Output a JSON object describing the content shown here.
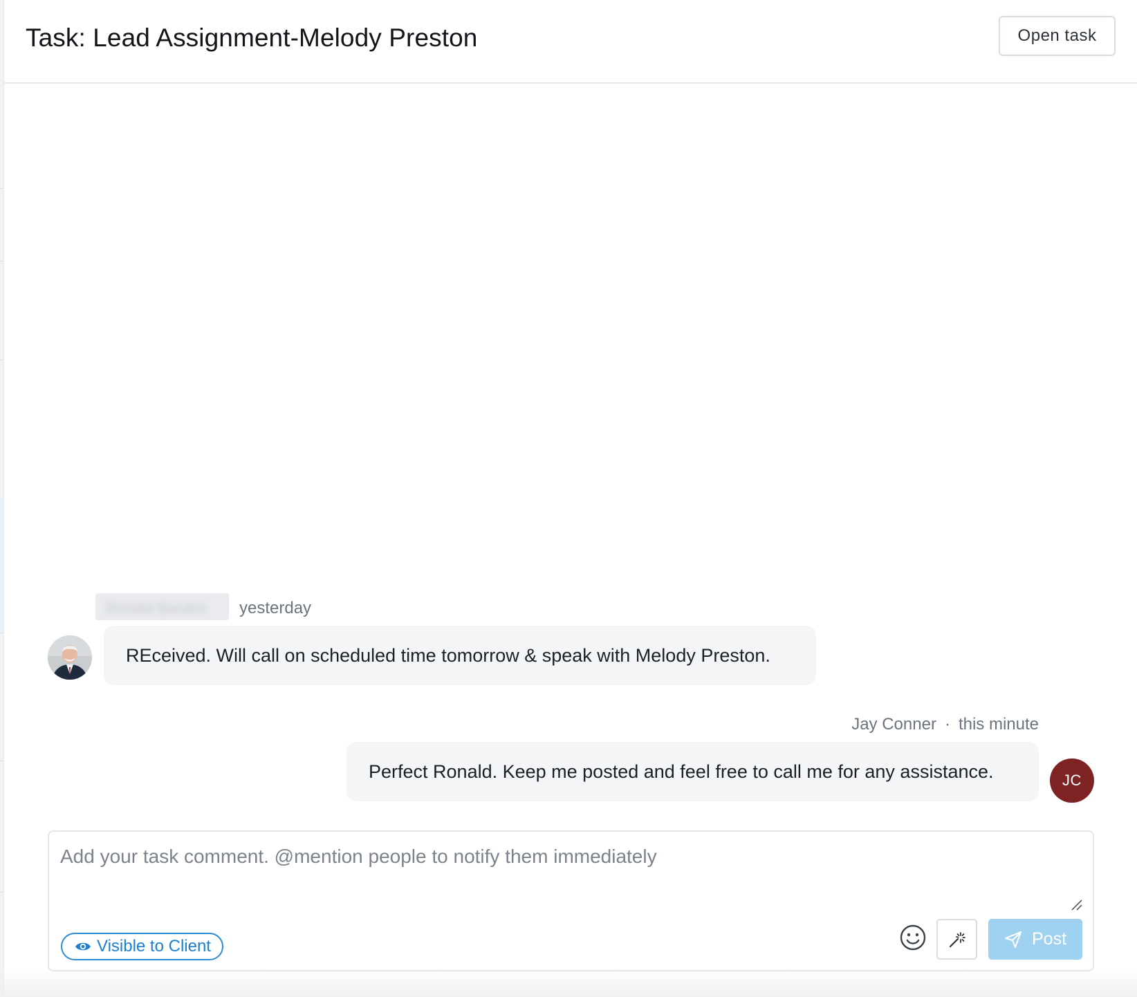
{
  "header": {
    "title": "Task: Lead Assignment-Melody Preston",
    "open_task_label": "Open task"
  },
  "comments": [
    {
      "author": "Ronald Barden",
      "time": "yesterday",
      "text": "REceived. Will call on scheduled time tomorrow & speak with Melody Preston.",
      "avatar": "photo"
    },
    {
      "author": "Jay Conner",
      "separator": "·",
      "time": "this minute",
      "text": "Perfect Ronald. Keep me posted and feel free to call me for any assistance.",
      "avatar_initials": "JC",
      "avatar_color": "#7d2323"
    }
  ],
  "composer": {
    "placeholder": "Add your task comment. @mention people to notify them immediately",
    "value": "",
    "visibility_label": "Visible to Client",
    "post_label": "Post",
    "icons": {
      "visibility": "eye-icon",
      "emoji": "smiley-icon",
      "magic": "magic-wand-icon",
      "post": "send-icon"
    }
  },
  "colors": {
    "accent": "#2b8cd6",
    "post_button": "#9fd2f0",
    "bubble": "#f4f5f7"
  }
}
